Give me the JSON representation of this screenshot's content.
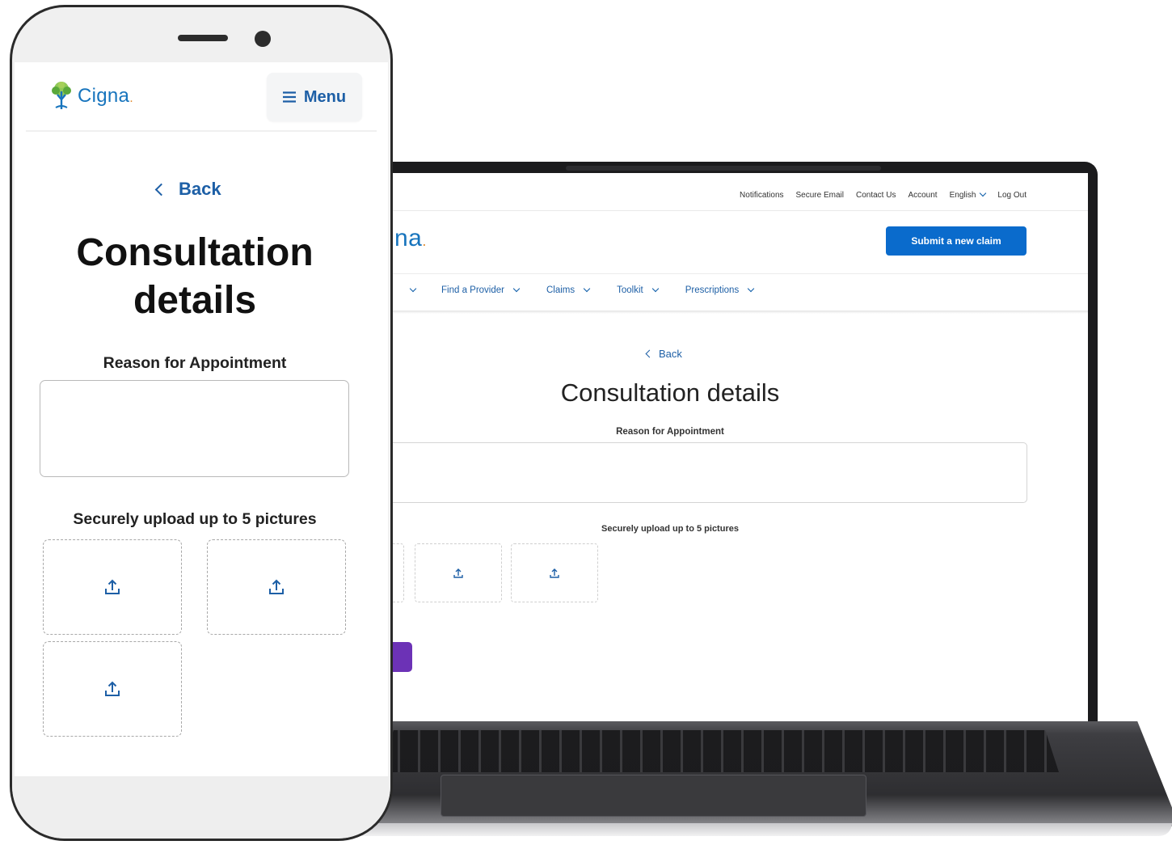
{
  "desktop": {
    "top_links": [
      "Notifications",
      "Secure Email",
      "Contact Us",
      "Account",
      "English",
      "Log Out"
    ],
    "logo_text": "na",
    "logo_dot": ".",
    "submit_button": "Submit a new claim",
    "main_nav": [
      "",
      "Find a Provider",
      "Claims",
      "Toolkit",
      "Prescriptions"
    ],
    "back_label": "Back",
    "page_title": "Consultation details",
    "reason_label": "Reason for Appointment",
    "upload_label": "Securely upload up to 5 pictures",
    "upload_icon": "upload-icon",
    "accent_color": "#0a6bcc",
    "cta_color": "#6c32b6"
  },
  "mobile": {
    "logo_text": "Cigna",
    "logo_dot": ".",
    "menu_label": "Menu",
    "menu_icon": "hamburger-icon",
    "back_label": "Back",
    "page_title_line1": "Consultation",
    "page_title_line2": "details",
    "reason_label": "Reason for Appointment",
    "upload_label": "Securely upload up to 5 pictures",
    "upload_icon": "upload-icon",
    "brand_color": "#1774bd"
  }
}
